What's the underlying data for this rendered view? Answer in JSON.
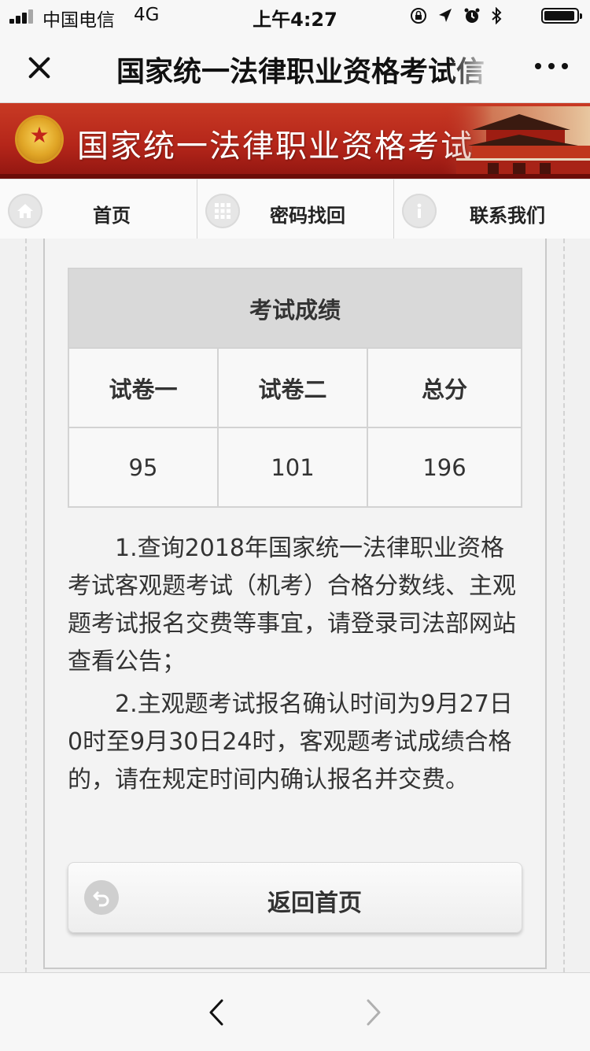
{
  "status_bar": {
    "carrier": "中国电信",
    "network": "4G",
    "time": "上午4:27",
    "icons": [
      "lock-rotation-icon",
      "location-arrow-icon",
      "alarm-icon",
      "bluetooth-icon",
      "battery-icon"
    ],
    "battery_level": 0.95
  },
  "nav_bar": {
    "title": "国家统一法律职业资格考试信",
    "close_icon": "close-icon",
    "more_icon": "more-dots-icon"
  },
  "banner": {
    "title": "国家统一法律职业资格考试",
    "emblem_icon": "national-emblem-icon",
    "image": "tiananmen-gate"
  },
  "menu": {
    "items": [
      {
        "label": "首页",
        "icon": "home-icon"
      },
      {
        "label": "密码找回",
        "icon": "grid-icon"
      },
      {
        "label": "联系我们",
        "icon": "info-icon"
      }
    ]
  },
  "score_table": {
    "caption": "考试成绩",
    "headers": [
      "试卷一",
      "试卷二",
      "总分"
    ],
    "values": [
      "95",
      "101",
      "196"
    ]
  },
  "notices": [
    "1.查询2018年国家统一法律职业资格考试客观题考试（机考）合格分数线、主观题考试报名交费等事宜，请登录司法部网站查看公告；",
    "2.主观题考试报名确认时间为9月27日0时至9月30日24时，客观题考试成绩合格的，请在规定时间内确认报名并交费。"
  ],
  "back_button": {
    "label": "返回首页",
    "icon": "return-arrow-icon"
  },
  "bottom_bar": {
    "back_icon": "chevron-left-icon",
    "forward_icon": "chevron-right-icon"
  },
  "colors": {
    "banner_red": "#b5261a",
    "table_header_gray": "#d9d9d9",
    "background": "#f3f3f3"
  }
}
